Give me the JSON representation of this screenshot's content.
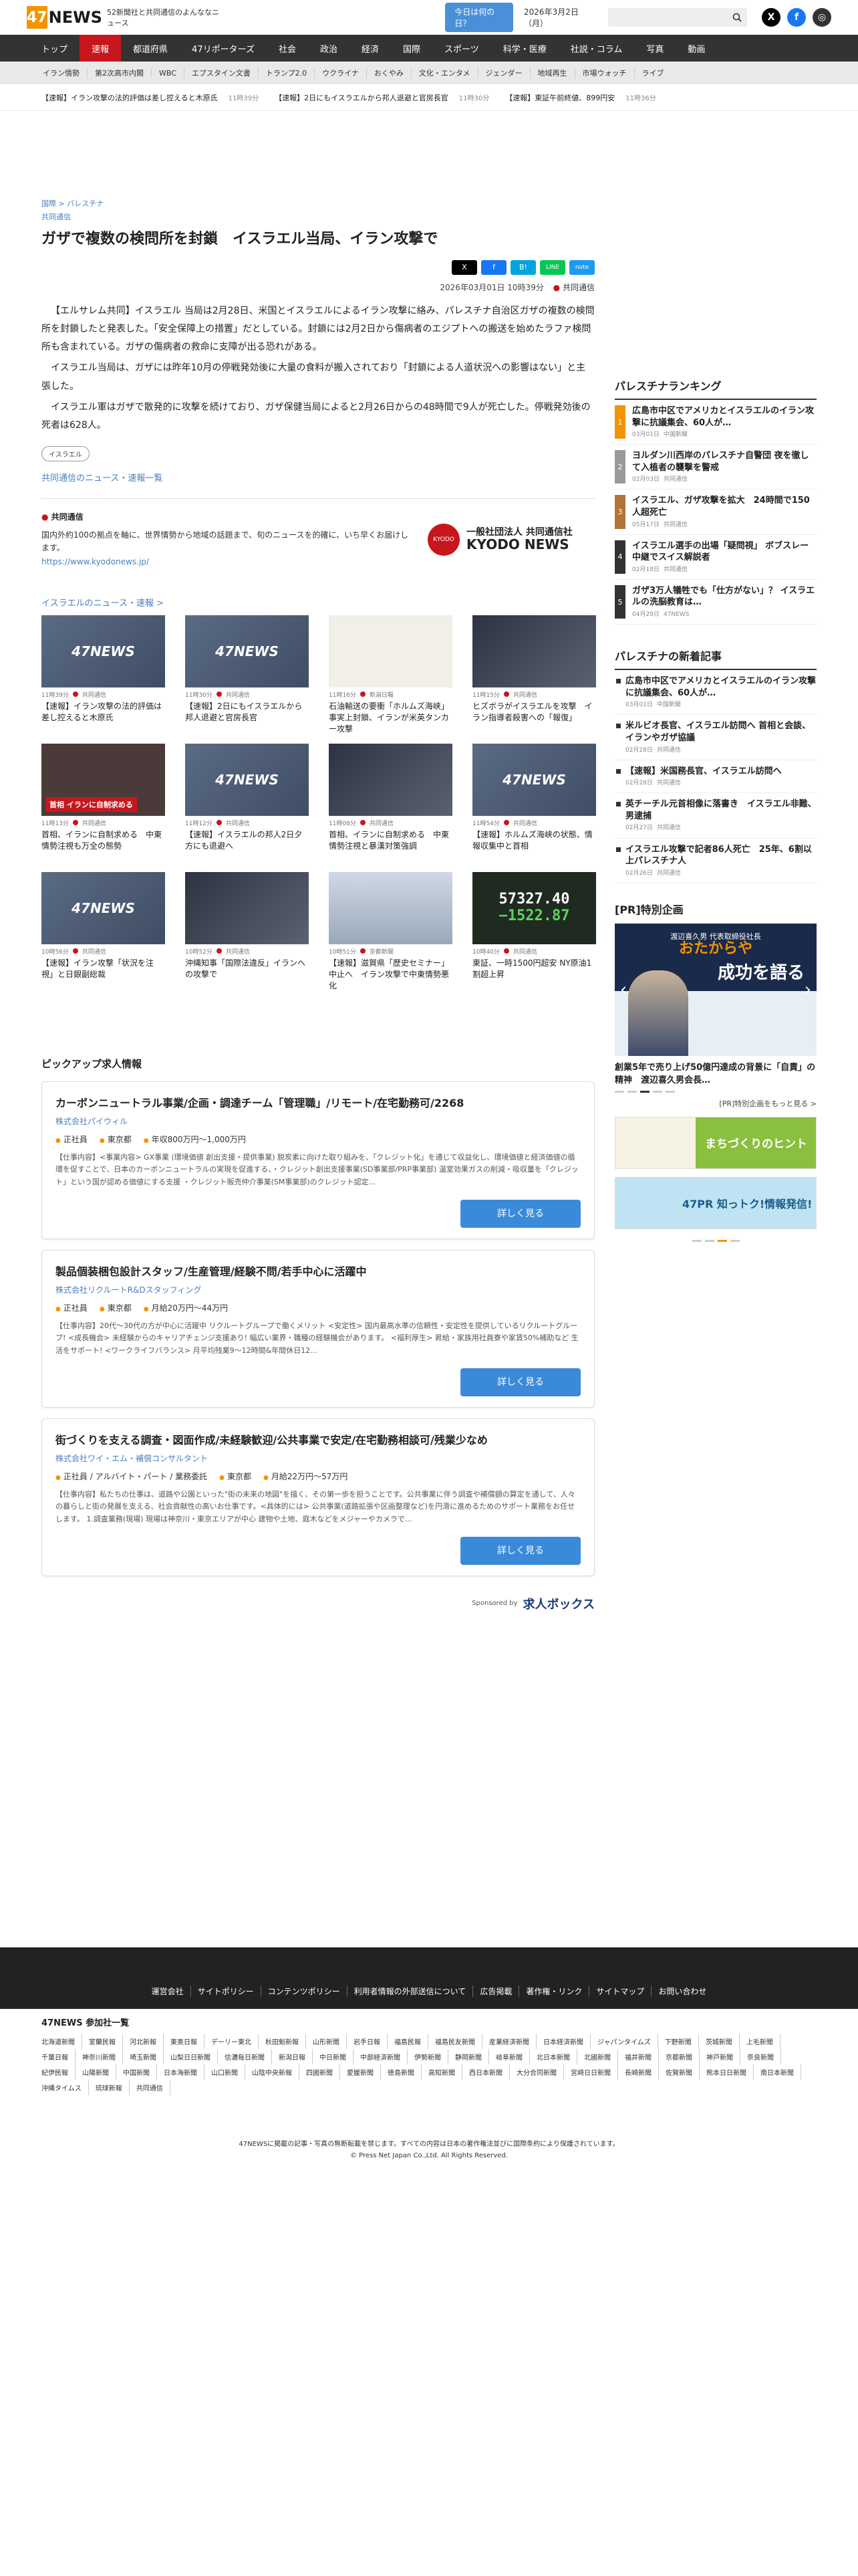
{
  "header": {
    "logo_num": "47",
    "logo_text": "NEWS",
    "tagline": "52新聞社と共同通信のよんななニュース",
    "today_button": "今日は何の日？",
    "date": "2026年3月2日（月）",
    "search_placeholder": ""
  },
  "nav_main": [
    "トップ",
    "速報",
    "都道府県",
    "47リポーターズ",
    "社会",
    "政治",
    "経済",
    "国際",
    "スポーツ",
    "科学・医療",
    "社説・コラム",
    "写真",
    "動画"
  ],
  "nav_sub": [
    "イラン情勢",
    "第2次高市内閣",
    "WBC",
    "エプスタイン文書",
    "トランプ2.0",
    "ウクライナ",
    "おくやみ",
    "文化・エンタメ",
    "ジェンダー",
    "地域再生",
    "市場ウォッチ",
    "ライブ"
  ],
  "ticker": [
    {
      "text": "【速報】イラン攻撃の法的評価は差し控えると木原氏",
      "time": "11時39分"
    },
    {
      "text": "【速報】2日にもイスラエルから邦人退避と官房長官",
      "time": "11時30分"
    },
    {
      "text": "【速報】東証午前終値、899円安",
      "time": "11時36分"
    }
  ],
  "article": {
    "breadcrumb": "国際 > パレスチナ",
    "category": "共同通信",
    "title": "ガザで複数の検問所を封鎖　イスラエル当局、イラン攻撃で",
    "share": [
      "X",
      "f",
      "B!",
      "LINE",
      "note"
    ],
    "datetime": "2026年03月01日 10時39分",
    "source": "共同通信",
    "paragraphs": [
      "【エルサレム共同】イスラエル 当局は2月28日、米国とイスラエルによるイラン攻撃に絡み、パレスチナ自治区ガザの複数の検問所を封鎖したと発表した。「安全保障上の措置」だとしている。封鎖には2月2日から傷病者のエジプトへの搬送を始めたラファ検問所も含まれている。ガザの傷病者の救命に支障が出る恐れがある。",
      "イスラエル当局は、ガザには昨年10月の停戦発効後に大量の食料が搬入されており「封鎖による人道状況への影響はない」と主張した。",
      "イスラエル軍はガザで散発的に攻撃を続けており、ガザ保健当局によると2月26日からの48時間で9人が死亡した。停戦発効後の死者は628人。"
    ],
    "tag": "イスラエル",
    "more_link": "共同通信のニュース・速報一覧"
  },
  "provider": {
    "name": "共同通信",
    "description": "国内外約100の拠点を軸に、世界情勢から地域の話題まで、旬のニュースを的確に、いち早くお届けします。",
    "url": "https://www.kyodonews.jp/",
    "logo_line1": "一般社団法人 共同通信社",
    "logo_line2": "KYODO NEWS"
  },
  "related": {
    "title": "イスラエルのニュース・速報 >",
    "items": [
      {
        "thumb": "ph",
        "time": "11時39分",
        "src": "共同通信",
        "title": "【速報】イラン攻撃の法的評価は差し控えると木原氏"
      },
      {
        "thumb": "ph",
        "time": "11時30分",
        "src": "共同通信",
        "title": "【速報】2日にもイスラエルから邦人退避と官房長官"
      },
      {
        "thumb": "map",
        "time": "11時16分",
        "src": "新潟日報",
        "title": "石油輸送の要衝「ホルムズ海峡」事実上封鎖、イランが米英タンカー攻撃"
      },
      {
        "thumb": "dark",
        "time": "11時15分",
        "src": "共同通信",
        "title": "ヒズボラがイスラエルを攻撃　イラン指導者殺害への「報復」"
      },
      {
        "thumb": "red",
        "caption": "首相 イランに自制求める",
        "time": "11時13分",
        "src": "共同通信",
        "title": "首相、イランに自制求める　中東情勢注視も万全の態勢"
      },
      {
        "thumb": "ph",
        "time": "11時12分",
        "src": "共同通信",
        "title": "【速報】イスラエルの邦人2日夕方にも退避へ"
      },
      {
        "thumb": "dark",
        "time": "11時08分",
        "src": "共同通信",
        "title": "首相、イランに自制求める　中東情勢注視と暴漢対策強調"
      },
      {
        "thumb": "ph",
        "time": "11時54分",
        "src": "共同通信",
        "title": "【速報】ホルムズ海峡の状態、情報収集中と首相"
      },
      {
        "thumb": "ph",
        "time": "10時56分",
        "src": "共同通信",
        "title": "【速報】イラン攻撃「状況を注視」と日銀副総裁"
      },
      {
        "thumb": "dark",
        "time": "10時52分",
        "src": "共同通信",
        "title": "沖縄知事「国際法違反」イランへの攻撃で"
      },
      {
        "thumb": "bld",
        "time": "10時51分",
        "src": "京都新聞",
        "title": "【速報】滋賀県「歴史セミナー」中止へ　イラン攻撃で中東情勢悪化"
      },
      {
        "thumb": "board",
        "board": "57327.40|−1522.87",
        "time": "10時40分",
        "src": "共同通信",
        "title": "東証、一時1500円超安 NY原油1割超上昇"
      }
    ]
  },
  "jobs": {
    "title": "ピックアップ求人情報",
    "items": [
      {
        "title": "カーボンニュートラル事業/企画・調達チーム「管理職」/リモート/在宅勤務可/2268",
        "company": "株式会社パイウィル",
        "type": "正社員",
        "place": "東京都",
        "salary": "年収800万円〜1,000万円",
        "desc": "【仕事内容】<事業内容> GX事業 (環境価値 創出支援・提供事業) 脱炭素に向けた取り組みを、「クレジット化」を通じて収益化し、環境価値と経済価値の循環を促すことで、日本のカーボンニュートラルの実現を促進する、・クレジット創出支援事業(SD事業部/PRP事業部) 温室効果ガスの削減・吸収量を「クレジット」という国が認める価値にする支援 ・クレジット販売仲介事業(SM事業部)のクレジット認定...",
        "button": "詳しく見る"
      },
      {
        "title": "製品個装梱包設計スタッフ/生産管理/経験不問/若手中心に活躍中",
        "company": "株式会社リクルートR&Dスタッフィング",
        "type": "正社員",
        "place": "東京都",
        "salary": "月給20万円〜44万円",
        "desc": "【仕事内容】20代〜30代の方が中心に活躍中 リクルートグループで働くメリット <安定性> 国内最高水準の信頼性・安定性を提供しているリクルートグループ! <成長機会> 未経験からのキャリアチェンジ支援あり! 幅広い業界・職種の経験機会があります。 <福利厚生> 昇給・家族用社員寮や家賃50%補助など 生活をサポート! <ワークライフバランス> 月平均残業9〜12時間&年間休日12...",
        "button": "詳しく見る"
      },
      {
        "title": "街づくりを支える調査・図面作成/未経験歓迎/公共事業で安定/在宅勤務相談可/残業少なめ",
        "company": "株式会社ワイ・エム・補償コンサルタント",
        "type": "正社員 / アルバイト・パート / 業務委託",
        "place": "東京都",
        "salary": "月給22万円〜57万円",
        "desc": "【仕事内容】私たちの仕事は、道路や公園といった\"街の未来の地図\"を描く、その第一歩を担うことです。公共事業に伴う調査や補償額の算定を通して、人々の暮らしと街の発展を支える、社会貢献性の高いお仕事です。<具体的には> 公共事業(道路拡張や区画整理など)を円滑に進めるためのサポート業務をお任せします。 1.調査業務(現場) 現場は神奈川・東京エリアが中心 建物や土地、庭木などをメジャーやカメラで...",
        "button": "詳しく見る"
      }
    ],
    "sponsor_label": "Sponsored by",
    "sponsor_name": "求人ボックス"
  },
  "ranking": {
    "title": "パレスチナランキング",
    "items": [
      {
        "rank": "1",
        "color": "#f29400",
        "title": "広島市中区でアメリカとイスラエルのイラン攻撃に抗議集会、60人が…",
        "date": "03月01日",
        "src": "中国新聞"
      },
      {
        "rank": "2",
        "color": "#9a9a9a",
        "title": "ヨルダン川西岸のパレスチナ自警団 夜を徹して入植者の襲撃を警戒",
        "date": "02月03日",
        "src": "共同通信"
      },
      {
        "rank": "3",
        "color": "#b5733a",
        "title": "イスラエル、ガザ攻撃を拡大　24時間で150人超死亡",
        "date": "05月17日",
        "src": "共同通信"
      },
      {
        "rank": "4",
        "color": "#333",
        "title": "イスラエル選手の出場「疑問視」 ボブスレー中継でスイス解説者",
        "date": "02月18日",
        "src": "共同通信"
      },
      {
        "rank": "5",
        "color": "#333",
        "title": "ガザ3万人犠牲でも「仕方がない」？ イスラエルの洗脳教育は…",
        "date": "04月29日",
        "src": "47NEWS"
      }
    ]
  },
  "latest": {
    "title": "パレスチナの新着記事",
    "items": [
      {
        "title": "広島市中区でアメリカとイスラエルのイラン攻撃に抗議集会、60人が…",
        "date": "03月01日",
        "src": "中国新聞"
      },
      {
        "title": "米ルビオ長官、イスラエル訪問へ 首相と会談、イランやガザ協議",
        "date": "02月28日",
        "src": "共同通信"
      },
      {
        "title": "【速報】米国務長官、イスラエル訪問へ",
        "date": "02月28日",
        "src": "共同通信"
      },
      {
        "title": "英チーチル元首相像に落書き　イスラエル非難、男逮捕",
        "date": "02月27日",
        "src": "共同通信"
      },
      {
        "title": "イスラエル攻撃で記者86人死亡　25年、6割以上パレスチナ人",
        "date": "02月26日",
        "src": "共同通信"
      }
    ]
  },
  "pr": {
    "title": "[PR]特別企画",
    "banner_top": "渡辺喜久男 代表取締役社長",
    "banner_brand": "おたからや",
    "banner_big": "成功を語る",
    "caption": "創業5年で売り上げ50億円達成の背景に「自責」の精神　渡辺喜久男会長…",
    "link": "[PR]特別企画をもっと見る >",
    "banner1": "まちづくりのヒント",
    "banner2": "47PR 知っトク!情報発信!"
  },
  "footer": {
    "links": [
      "運営会社",
      "サイトポリシー",
      "コンテンツポリシー",
      "利用者情報の外部送信について",
      "広告掲載",
      "著作権・リンク",
      "サイトマップ",
      "お問い合わせ"
    ],
    "papers_title": "47NEWS 参加社一覧",
    "papers": [
      "北海道新聞",
      "室蘭民報",
      "河北新報",
      "東奥日報",
      "デーリー東北",
      "秋田魁新報",
      "山形新聞",
      "岩手日報",
      "福島民報",
      "福島民友新聞",
      "産業経済新聞",
      "日本経済新聞",
      "ジャパンタイムズ",
      "下野新聞",
      "茨城新聞",
      "上毛新聞",
      "千葉日報",
      "神奈川新聞",
      "埼玉新聞",
      "山梨日日新聞",
      "信濃毎日新聞",
      "新潟日報",
      "中日新聞",
      "中部経済新聞",
      "伊勢新聞",
      "静岡新聞",
      "岐阜新聞",
      "北日本新聞",
      "北國新聞",
      "福井新聞",
      "京都新聞",
      "神戸新聞",
      "奈良新聞",
      "紀伊民報",
      "山陽新聞",
      "中国新聞",
      "日本海新聞",
      "山口新聞",
      "山陰中央新報",
      "四國新聞",
      "愛媛新聞",
      "徳島新聞",
      "高知新聞",
      "西日本新聞",
      "大分合同新聞",
      "宮崎日日新聞",
      "長崎新聞",
      "佐賀新聞",
      "熊本日日新聞",
      "南日本新聞",
      "沖縄タイムス",
      "琉球新報",
      "共同通信"
    ],
    "notice": "47NEWSに掲載の記事・写真の無断転載を禁じます。すべての内容は日本の著作権法並びに国際条約により保護されています。",
    "copyright": "© Press Net Japan Co.,Ltd. All Rights Reserved."
  }
}
